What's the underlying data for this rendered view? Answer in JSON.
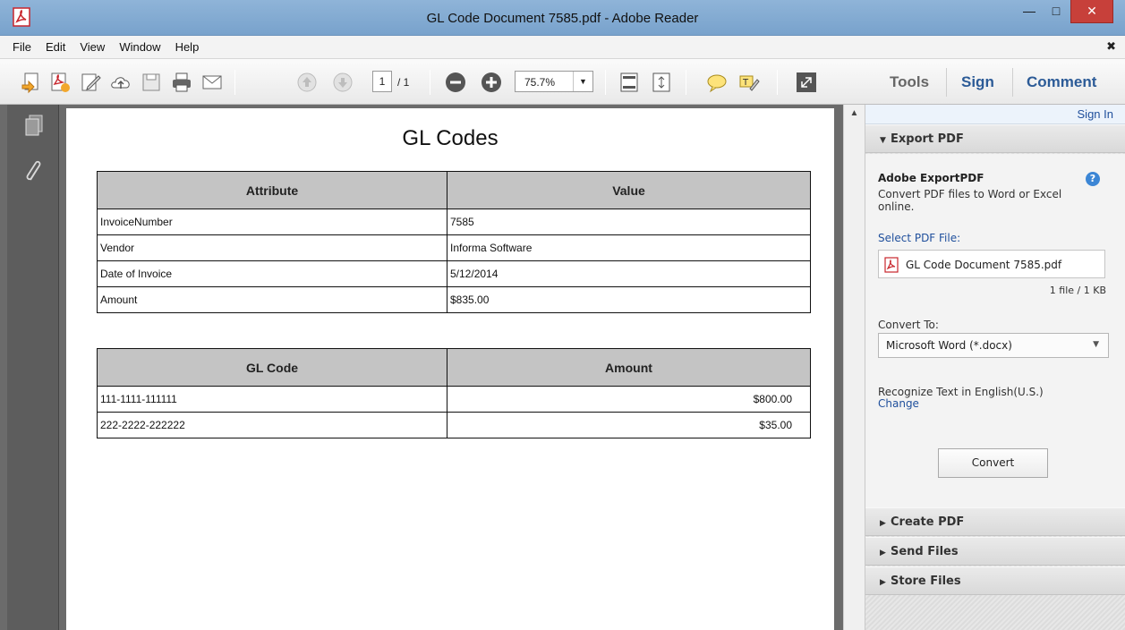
{
  "window": {
    "title": "GL Code Document 7585.pdf - Adobe Reader"
  },
  "menu": [
    "File",
    "Edit",
    "View",
    "Window",
    "Help"
  ],
  "toolbar": {
    "page_current": "1",
    "page_total": "/ 1",
    "zoom": "75.7%",
    "tools_label": "Tools",
    "sign_label": "Sign",
    "comment_label": "Comment"
  },
  "document": {
    "title": "GL Codes",
    "attributes_table": {
      "headers": [
        "Attribute",
        "Value"
      ],
      "rows": [
        [
          "InvoiceNumber",
          "7585"
        ],
        [
          "Vendor",
          "Informa Software"
        ],
        [
          "Date of Invoice",
          "5/12/2014"
        ],
        [
          "Amount",
          "$835.00"
        ]
      ]
    },
    "gl_table": {
      "headers": [
        "GL Code",
        "Amount"
      ],
      "rows": [
        [
          "111-1111-111111",
          "$800.00"
        ],
        [
          "222-2222-222222",
          "$35.00"
        ]
      ]
    }
  },
  "panel": {
    "sign_in": "Sign In",
    "export": {
      "header": "Export PDF",
      "title": "Adobe ExportPDF",
      "description": "Convert PDF files to Word or Excel online.",
      "select_label": "Select PDF File:",
      "file_name": "GL Code Document 7585.pdf",
      "file_info": "1 file / 1 KB",
      "convert_to_label": "Convert To:",
      "convert_to_value": "Microsoft Word (*.docx)",
      "recognize_text": "Recognize Text in English(U.S.)",
      "change_link": "Change",
      "convert_button": "Convert"
    },
    "sections": [
      "Create PDF",
      "Send Files",
      "Store Files"
    ]
  },
  "colors": {
    "title_bar": "#8fb4d8",
    "close_button": "#c7403a",
    "link_blue": "#1f4f9c",
    "table_header": "#c4c4c4",
    "pdf_red": "#c8252c"
  }
}
